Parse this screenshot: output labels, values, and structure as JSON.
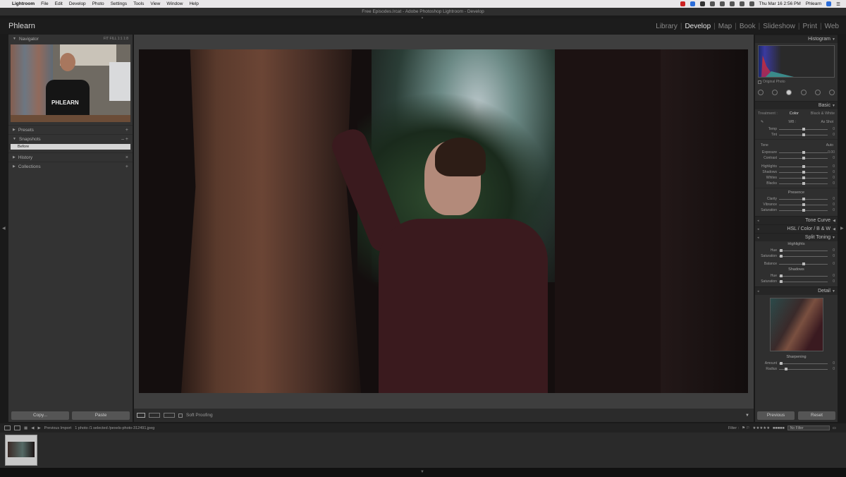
{
  "macmenu": {
    "app": "Lightroom",
    "items": [
      "File",
      "Edit",
      "Develop",
      "Photo",
      "Settings",
      "Tools",
      "View",
      "Window",
      "Help"
    ],
    "clock": "Thu Mar 16  2:56 PM",
    "user": "Phlearn"
  },
  "window_title": "Free Episodes.lrcat - Adobe Photoshop Lightroom - Develop",
  "identity": "Phlearn",
  "modules": [
    "Library",
    "Develop",
    "Map",
    "Book",
    "Slideshow",
    "Print",
    "Web"
  ],
  "active_module": "Develop",
  "left_panel": {
    "navigator": {
      "title": "Navigator",
      "options": "FIT  FILL  1:1  1:8",
      "shirt_text": "PHLEARN"
    },
    "presets": "Presets",
    "snapshots": {
      "title": "Snapshots",
      "items": [
        "Before"
      ]
    },
    "history": "History",
    "collections": "Collections",
    "copy_label": "Copy...",
    "paste_label": "Paste"
  },
  "center": {
    "soft_proofing": "Soft Proofing"
  },
  "right_panel": {
    "histogram": "Histogram",
    "original_photo": "Original Photo",
    "basic": "Basic",
    "treatment": "Treatment :",
    "color": "Color",
    "bw": "Black & White",
    "wb": "WB :",
    "as_shot": "As Shot",
    "temp": "Temp",
    "tint": "Tint",
    "tone": "Tone",
    "auto": "Auto",
    "exposure": "Exposure",
    "exposure_val": "0.00",
    "contrast": "Contrast",
    "highlights": "Highlights",
    "shadows": "Shadows",
    "whites": "Whites",
    "blacks": "Blacks",
    "presence": "Presence",
    "clarity": "Clarity",
    "vibrance": "Vibrance",
    "saturation": "Saturation",
    "tone_curve": "Tone Curve",
    "hsl": "HSL  /  Color  /  B & W",
    "split_toning": "Split Toning",
    "st_highlights": "Highlights",
    "hue": "Hue",
    "st_saturation": "Saturation",
    "balance": "Balance",
    "st_shadows": "Shadows",
    "detail": "Detail",
    "sharpening": "Sharpening",
    "amount": "Amount",
    "radius": "Radius",
    "zero": "0",
    "previous_label": "Previous",
    "reset_label": "Reset"
  },
  "filmstrip": {
    "source": "Previous Import",
    "info": "1 photo /1 selected /pexels-photo-312491.jpeg",
    "filter_label": "Filter :",
    "no_filter": "No Filter"
  }
}
